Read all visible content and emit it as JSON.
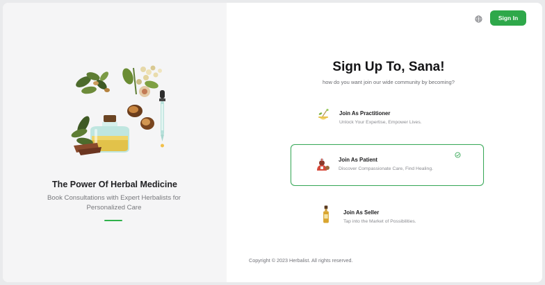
{
  "left_panel": {
    "title": "The Power Of Herbal Medicine",
    "description": "Book Consultations with Expert Herbalists for Personalized Care",
    "illustration": "herbal-medicine-illustration"
  },
  "header": {
    "language_icon": "globe-icon",
    "sign_in_label": "Sign In"
  },
  "main": {
    "heading": "Sign Up To, Sana!",
    "subheading": "how do you want join our wide community by becoming?",
    "options": [
      {
        "title": "Join As Practitioner",
        "description": "Unlock Your Expertise, Empower Lives.",
        "icon": "mortar-herb-icon",
        "selected": false
      },
      {
        "title": "Join As Patient",
        "description": "Discover Compassionate Care, Find Healing.",
        "icon": "patient-icon",
        "selected": true
      },
      {
        "title": "Join As Seller",
        "description": "Tap into the Market of Possibilities.",
        "icon": "oil-bottle-icon",
        "selected": false
      }
    ]
  },
  "footer": {
    "copyright": "Copyright © 2023 Herbalist. All rights reserved."
  },
  "colors": {
    "accent": "#2ea84a",
    "selected_border": "#3aa95a",
    "left_background": "#f5f5f6"
  }
}
